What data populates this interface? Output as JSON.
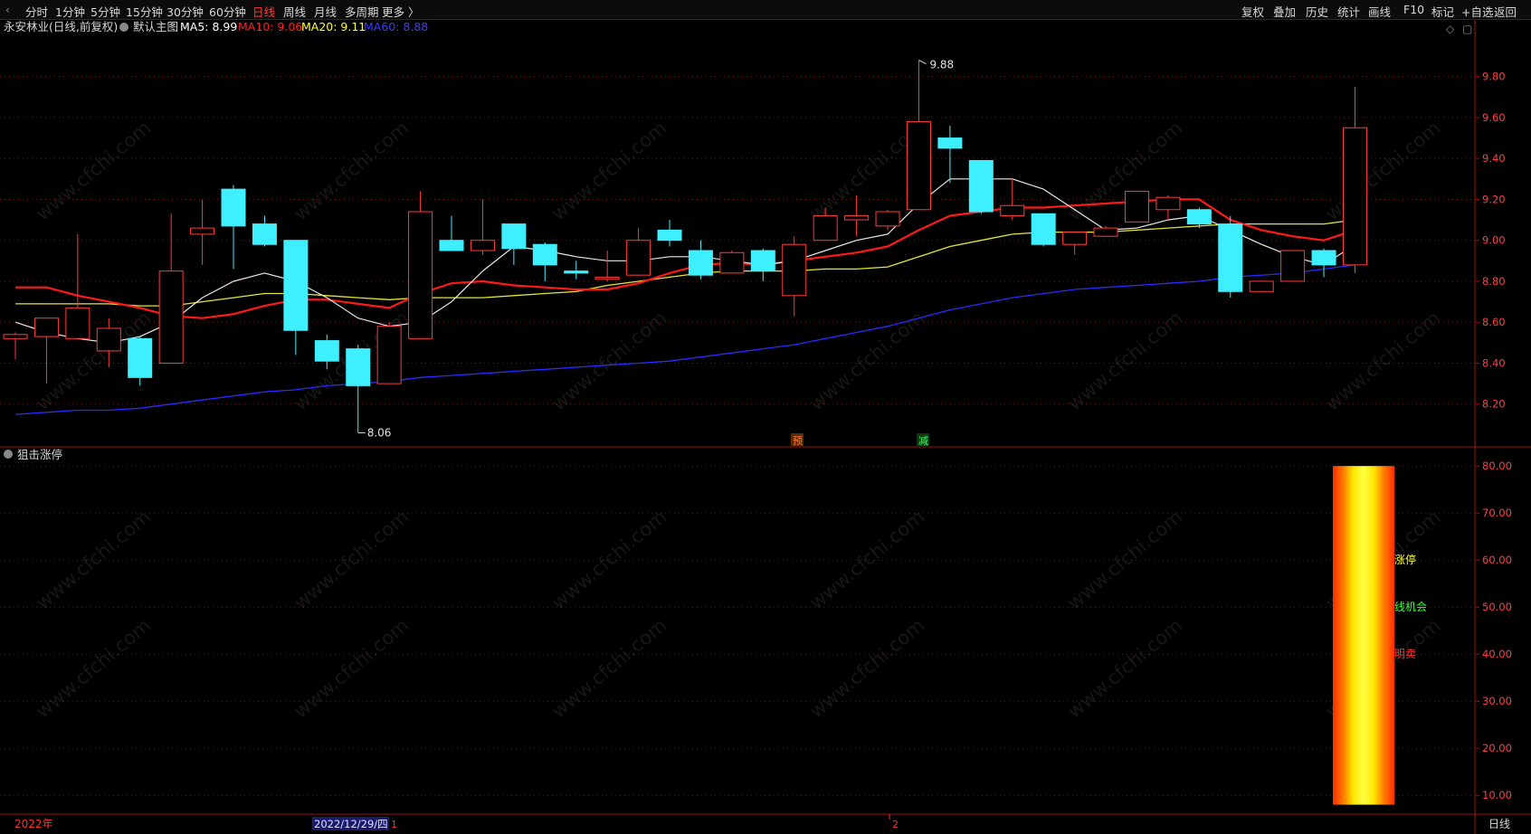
{
  "toolbar": {
    "left": [
      "分时",
      "1分钟",
      "5分钟",
      "15分钟",
      "30分钟",
      "60分钟",
      "日线",
      "周线",
      "月线",
      "多周期",
      "更多 〉"
    ],
    "active": "日线",
    "right": [
      "复权",
      "叠加",
      "历史",
      "统计",
      "画线",
      "F10",
      "标记",
      "+自选",
      "返回"
    ]
  },
  "main_panel": {
    "stock_title": "永安林业(日线,前复权)",
    "indicator_title": "默认主图",
    "ma": [
      {
        "label": "MA5: 8.99",
        "color": "#ffffff"
      },
      {
        "label": "MA10: 9.06",
        "color": "#ff2020"
      },
      {
        "label": "MA20: 9.11",
        "color": "#ffff33"
      },
      {
        "label": "MA60: 8.88",
        "color": "#3a3aff"
      }
    ],
    "high_label": "9.88",
    "low_label": "8.06",
    "signal_labels": [
      "预",
      "减"
    ],
    "diamond_icon": "◇",
    "square_icon": "▢"
  },
  "sub_panel": {
    "title": "狙击涨停",
    "text_labels": [
      {
        "text": "涨停",
        "color": "#ffff33"
      },
      {
        "text": "线机会",
        "color": "#33ff33"
      },
      {
        "text": "明卖",
        "color": "#ff3333"
      }
    ]
  },
  "watermark": "www.cfchi.com",
  "bottom_bar": {
    "year_label": "2022年",
    "date_label": "2022/12/29/四",
    "tick_1": "1",
    "tick_2": "2",
    "period_label": "日线"
  },
  "chart_data": {
    "type": "candlestick",
    "candles": [
      {
        "o": 8.52,
        "h": 8.55,
        "l": 8.42,
        "c": 8.54
      },
      {
        "o": 8.53,
        "h": 8.6,
        "l": 8.3,
        "c": 8.62
      },
      {
        "o": 8.52,
        "h": 9.03,
        "l": 8.52,
        "c": 8.67
      },
      {
        "o": 8.46,
        "h": 8.62,
        "l": 8.38,
        "c": 8.57
      },
      {
        "o": 8.52,
        "h": 8.53,
        "l": 8.29,
        "c": 8.33
      },
      {
        "o": 8.4,
        "h": 9.13,
        "l": 8.4,
        "c": 8.85
      },
      {
        "o": 9.03,
        "h": 9.2,
        "l": 8.88,
        "c": 9.06
      },
      {
        "o": 9.25,
        "h": 9.27,
        "l": 8.86,
        "c": 9.07
      },
      {
        "o": 9.08,
        "h": 9.12,
        "l": 8.97,
        "c": 8.98
      },
      {
        "o": 9.0,
        "h": 9.0,
        "l": 8.44,
        "c": 8.56
      },
      {
        "o": 8.51,
        "h": 8.54,
        "l": 8.37,
        "c": 8.41
      },
      {
        "o": 8.47,
        "h": 8.49,
        "l": 8.06,
        "c": 8.29
      },
      {
        "o": 8.3,
        "h": 8.6,
        "l": 8.3,
        "c": 8.58
      },
      {
        "o": 8.52,
        "h": 9.24,
        "l": 8.52,
        "c": 9.14
      },
      {
        "o": 9.0,
        "h": 9.12,
        "l": 8.95,
        "c": 8.95
      },
      {
        "o": 8.95,
        "h": 9.2,
        "l": 8.93,
        "c": 9.0
      },
      {
        "o": 9.08,
        "h": 9.08,
        "l": 8.88,
        "c": 8.96
      },
      {
        "o": 8.98,
        "h": 8.99,
        "l": 8.8,
        "c": 8.88
      },
      {
        "o": 8.85,
        "h": 8.9,
        "l": 8.81,
        "c": 8.84
      },
      {
        "o": 8.81,
        "h": 8.95,
        "l": 8.8,
        "c": 8.82
      },
      {
        "o": 8.83,
        "h": 9.06,
        "l": 8.83,
        "c": 9.0
      },
      {
        "o": 9.05,
        "h": 9.1,
        "l": 8.97,
        "c": 9.0
      },
      {
        "o": 8.95,
        "h": 9.0,
        "l": 8.81,
        "c": 8.83
      },
      {
        "o": 8.84,
        "h": 8.95,
        "l": 8.84,
        "c": 8.94
      },
      {
        "o": 8.95,
        "h": 8.96,
        "l": 8.8,
        "c": 8.85
      },
      {
        "o": 8.73,
        "h": 9.02,
        "l": 8.63,
        "c": 8.98
      },
      {
        "o": 9.0,
        "h": 9.16,
        "l": 9.0,
        "c": 9.12
      },
      {
        "o": 9.1,
        "h": 9.22,
        "l": 9.02,
        "c": 9.12
      },
      {
        "o": 9.07,
        "h": 9.15,
        "l": 9.05,
        "c": 9.14
      },
      {
        "o": 9.15,
        "h": 9.88,
        "l": 9.15,
        "c": 9.58
      },
      {
        "o": 9.5,
        "h": 9.56,
        "l": 9.28,
        "c": 9.45
      },
      {
        "o": 9.39,
        "h": 9.39,
        "l": 9.13,
        "c": 9.14
      },
      {
        "o": 9.12,
        "h": 9.3,
        "l": 9.1,
        "c": 9.17
      },
      {
        "o": 9.13,
        "h": 9.13,
        "l": 8.97,
        "c": 8.98
      },
      {
        "o": 8.98,
        "h": 9.04,
        "l": 8.93,
        "c": 9.04
      },
      {
        "o": 9.02,
        "h": 9.07,
        "l": 9.02,
        "c": 9.06
      },
      {
        "o": 9.09,
        "h": 9.24,
        "l": 9.09,
        "c": 9.24
      },
      {
        "o": 9.15,
        "h": 9.22,
        "l": 9.1,
        "c": 9.21
      },
      {
        "o": 9.15,
        "h": 9.16,
        "l": 9.06,
        "c": 9.08
      },
      {
        "o": 9.08,
        "h": 9.12,
        "l": 8.72,
        "c": 8.75
      },
      {
        "o": 8.75,
        "h": 8.8,
        "l": 8.75,
        "c": 8.8
      },
      {
        "o": 8.8,
        "h": 8.95,
        "l": 8.8,
        "c": 8.95
      },
      {
        "o": 8.95,
        "h": 8.96,
        "l": 8.82,
        "c": 8.88
      },
      {
        "o": 8.88,
        "h": 9.75,
        "l": 8.84,
        "c": 9.55
      }
    ],
    "ma5": [
      8.6,
      8.55,
      8.52,
      8.5,
      8.53,
      8.6,
      8.72,
      8.8,
      8.84,
      8.8,
      8.72,
      8.62,
      8.58,
      8.6,
      8.7,
      8.85,
      8.97,
      8.95,
      8.92,
      8.9,
      8.9,
      8.92,
      8.92,
      8.9,
      8.88,
      8.9,
      8.95,
      9.0,
      9.03,
      9.18,
      9.3,
      9.3,
      9.3,
      9.25,
      9.15,
      9.05,
      9.06,
      9.1,
      9.12,
      9.05,
      8.98,
      8.92,
      8.88,
      8.98
    ],
    "ma10": [
      8.77,
      8.77,
      8.73,
      8.7,
      8.67,
      8.63,
      8.62,
      8.64,
      8.68,
      8.71,
      8.71,
      8.69,
      8.67,
      8.74,
      8.79,
      8.8,
      8.78,
      8.77,
      8.76,
      8.76,
      8.79,
      8.84,
      8.88,
      8.89,
      8.88,
      8.9,
      8.92,
      8.94,
      8.97,
      9.05,
      9.12,
      9.14,
      9.16,
      9.16,
      9.17,
      9.18,
      9.19,
      9.2,
      9.2,
      9.1,
      9.05,
      9.02,
      9.0,
      9.05
    ],
    "ma20": [
      8.69,
      8.69,
      8.69,
      8.69,
      8.68,
      8.68,
      8.7,
      8.72,
      8.74,
      8.74,
      8.73,
      8.72,
      8.71,
      8.72,
      8.72,
      8.72,
      8.73,
      8.74,
      8.75,
      8.78,
      8.8,
      8.82,
      8.84,
      8.85,
      8.85,
      8.85,
      8.86,
      8.86,
      8.87,
      8.92,
      8.97,
      9.0,
      9.03,
      9.04,
      9.04,
      9.04,
      9.05,
      9.06,
      9.07,
      9.08,
      9.08,
      9.08,
      9.08,
      9.1
    ],
    "ma60": [
      8.15,
      8.16,
      8.17,
      8.17,
      8.18,
      8.2,
      8.22,
      8.24,
      8.26,
      8.27,
      8.29,
      8.3,
      8.31,
      8.33,
      8.34,
      8.35,
      8.36,
      8.37,
      8.38,
      8.39,
      8.4,
      8.41,
      8.43,
      8.45,
      8.47,
      8.49,
      8.52,
      8.55,
      8.58,
      8.62,
      8.66,
      8.69,
      8.72,
      8.74,
      8.76,
      8.77,
      8.78,
      8.79,
      8.8,
      8.82,
      8.83,
      8.84,
      8.86,
      8.88
    ],
    "main_axis": {
      "ticks": [
        "9.80",
        "9.60",
        "9.40",
        "9.20",
        "9.00",
        "8.80",
        "8.60",
        "8.40",
        "8.20"
      ],
      "range": [
        8.0,
        9.94
      ]
    },
    "sub_axis": {
      "ticks": [
        "80.00",
        "70.00",
        "60.00",
        "50.00",
        "40.00",
        "30.00",
        "20.00",
        "10.00"
      ],
      "range": [
        6.0,
        84.0
      ]
    },
    "sub_bar": {
      "from": 8.0,
      "to": 80.0,
      "colors": [
        "#ff2a00",
        "#ff7a00",
        "#ffe600",
        "#ffff44",
        "#ffe600",
        "#ff7a00",
        "#ff2a00"
      ]
    }
  }
}
